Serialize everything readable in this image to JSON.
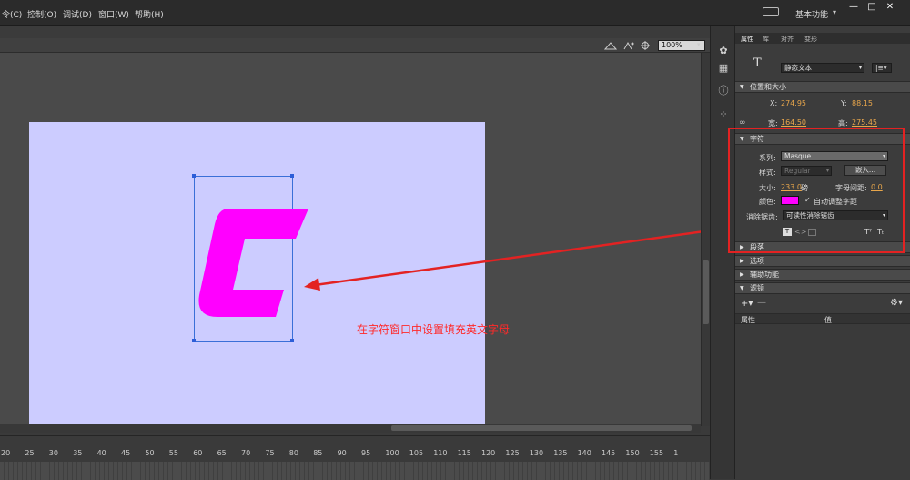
{
  "menubar": {
    "items": [
      "令(C)",
      "控制(O)",
      "调试(D)",
      "窗口(W)",
      "帮助(H)"
    ],
    "workspace": "基本功能",
    "workspace_arrow": "▾",
    "win_min": "—",
    "win_max": "□",
    "win_close": "✕"
  },
  "editbar": {
    "zoom": "100%"
  },
  "timeline": {
    "ticks": [
      "20",
      "25",
      "30",
      "35",
      "40",
      "45",
      "50",
      "55",
      "60",
      "65",
      "70",
      "75",
      "80",
      "85",
      "90",
      "95",
      "100",
      "105",
      "110",
      "115",
      "120",
      "125",
      "130",
      "135",
      "140",
      "145",
      "150",
      "155",
      "1"
    ]
  },
  "panel": {
    "tabs": [
      "属性",
      "库",
      "对齐",
      "变形"
    ],
    "text_type": "静态文本",
    "orientation": "|≡▾",
    "position_size": {
      "header": "位置和大小",
      "x_label": "X:",
      "x_value": "274.95",
      "y_label": "Y:",
      "y_value": "88.15",
      "w_label": "宽:",
      "w_value": "164.50",
      "h_label": "高:",
      "h_value": "275.45"
    },
    "character": {
      "header": "字符",
      "family_label": "系列:",
      "family_value": "Masque",
      "style_label": "样式:",
      "style_value": "Regular",
      "embed_button": "嵌入...",
      "size_label": "大小:",
      "size_value": "233.0",
      "size_unit": "磅",
      "spacing_label": "字母间距:",
      "spacing_value": "0.0",
      "color_label": "颜色:",
      "color_value": "#ff00ff",
      "autokern_label": "自动调整字距",
      "antialias_label": "消除锯齿:",
      "antialias_value": "可读性消除锯齿"
    },
    "sections": [
      "段落",
      "选项",
      "辅助功能",
      "滤镜"
    ],
    "filter_table": {
      "col_property": "属性",
      "col_value": "值"
    }
  },
  "stage": {
    "glyph": "C",
    "glyph_color": "#ff00ff",
    "background": "#ccccff"
  },
  "annotation": {
    "text": "在字符窗口中设置填充英文字母",
    "color": "#ff2a2a"
  }
}
